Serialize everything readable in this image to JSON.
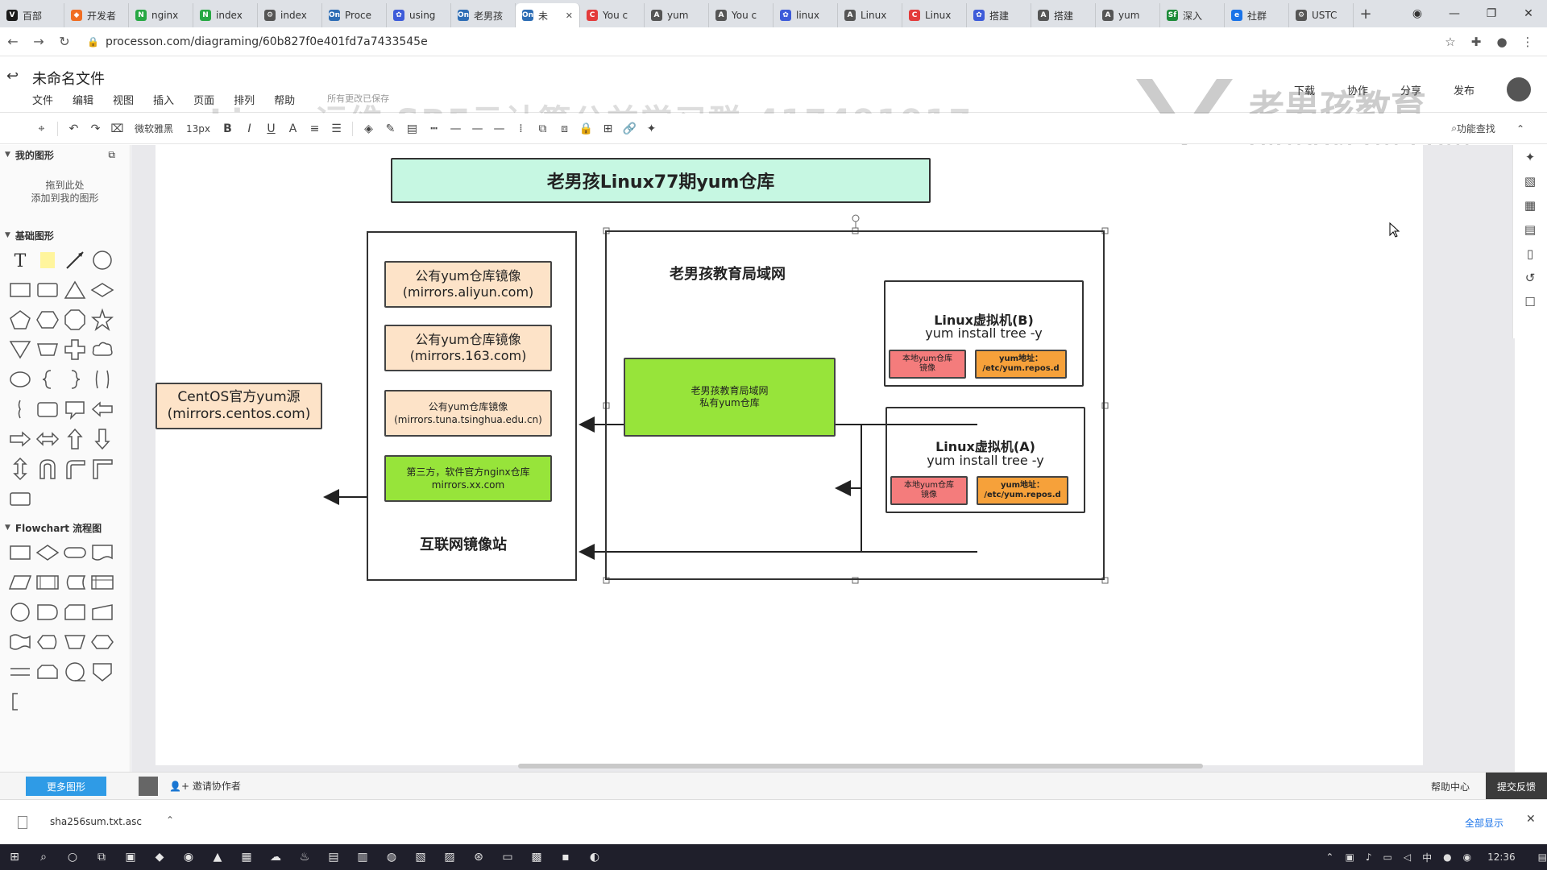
{
  "browser": {
    "tabs": [
      {
        "label": "百部",
        "color": "#1a1a1a",
        "glyph": "V"
      },
      {
        "label": "开发者",
        "color": "#f06d22",
        "glyph": "◆"
      },
      {
        "label": "nginx",
        "color": "#27a844",
        "glyph": "N"
      },
      {
        "label": "index",
        "color": "#27a844",
        "glyph": "N"
      },
      {
        "label": "index",
        "color": "#555555",
        "glyph": "⚙"
      },
      {
        "label": "Proce",
        "color": "#2d6db5",
        "glyph": "On"
      },
      {
        "label": "using",
        "color": "#3d5bd9",
        "glyph": "✿"
      },
      {
        "label": "老男孩",
        "color": "#2d6db5",
        "glyph": "On"
      },
      {
        "label": "未",
        "color": "#2d6db5",
        "glyph": "On",
        "active": true
      },
      {
        "label": "You c",
        "color": "#e33b3b",
        "glyph": "C"
      },
      {
        "label": "yum",
        "color": "#555555",
        "glyph": "A"
      },
      {
        "label": "You c",
        "color": "#555555",
        "glyph": "A"
      },
      {
        "label": "linux",
        "color": "#3d5bd9",
        "glyph": "✿"
      },
      {
        "label": "Linux",
        "color": "#555555",
        "glyph": "A"
      },
      {
        "label": "Linux",
        "color": "#e33b3b",
        "glyph": "C"
      },
      {
        "label": "搭建",
        "color": "#3d5bd9",
        "glyph": "✿"
      },
      {
        "label": "搭建",
        "color": "#555555",
        "glyph": "A"
      },
      {
        "label": "yum",
        "color": "#555555",
        "glyph": "A"
      },
      {
        "label": "深入",
        "color": "#1e8c3a",
        "glyph": "Sf"
      },
      {
        "label": "社群",
        "color": "#1a73e8",
        "glyph": "e"
      },
      {
        "label": "USTC",
        "color": "#555555",
        "glyph": "⚙"
      }
    ],
    "new_tab": "+",
    "url": "processon.com/diagraming/60b827f0e401fd7a7433545e"
  },
  "app": {
    "file_title": "未命名文件",
    "menu": [
      "文件",
      "编辑",
      "视图",
      "插入",
      "页面",
      "排列",
      "帮助"
    ],
    "save_status": "所有更改已保存",
    "header_buttons": [
      "下载",
      "协作",
      "分享",
      "发布"
    ],
    "watermark": "Linux运维 SRE云计算公益学习群:417491917",
    "logo_text": "老男孩教育",
    "logo_sub": "oldboyedu.com"
  },
  "toolbar": {
    "font_family": "微软雅黑",
    "font_size": "13px",
    "search_label": "功能查找"
  },
  "sidebar": {
    "my_shapes_title": "我的图形",
    "drop_hint_line1": "拖到此处",
    "drop_hint_line2": "添加到我的图形",
    "basic_title": "基础图形",
    "flowchart_title": "Flowchart 流程图",
    "more_shapes": "更多图形",
    "invite": "邀请协作者"
  },
  "diagram": {
    "title": "老男孩Linux77期yum仓库",
    "centos_line1": "CentOS官方yum源",
    "centos_line2": "(mirrors.centos.com)",
    "mirror_aliyun_line1": "公有yum仓库镜像",
    "mirror_aliyun_line2": "(mirrors.aliyun.com)",
    "mirror_163_line1": "公有yum仓库镜像",
    "mirror_163_line2": "(mirrors.163.com)",
    "mirror_tuna_line1": "公有yum仓库镜像",
    "mirror_tuna_line2": "(mirrors.tuna.tsinghua.edu.cn)",
    "third_party_line1": "第三方，软件官方nginx仓库",
    "third_party_line2": "mirrors.xx.com",
    "internet_label": "互联网镜像站",
    "lan_label": "老男孩教育局域网",
    "private_line1": "老男孩教育局域网",
    "private_line2": "私有yum仓库",
    "vm_b_title": "Linux虚拟机(B)",
    "vm_b_cmd": "yum install tree -y",
    "vm_a_title": "Linux虚拟机(A)",
    "vm_a_cmd": "yum install tree -y",
    "local_mirror_line1": "本地yum仓库",
    "local_mirror_line2": "镜像",
    "yum_addr_line1": "yum地址：",
    "yum_addr_line2": "/etc/yum.repos.d"
  },
  "bottom": {
    "help_center": "帮助中心",
    "feedback": "提交反馈"
  },
  "download": {
    "filename": "sha256sum.txt.asc",
    "show_all": "全部显示"
  },
  "taskbar": {
    "ime": "中",
    "time": "12:36"
  },
  "colors": {
    "title_fill": "#c6f7e2",
    "peach": "#fde3c8",
    "green": "#97e43a",
    "red": "#f47c7c",
    "orange": "#f6a13a",
    "accent": "#2f9be6"
  }
}
